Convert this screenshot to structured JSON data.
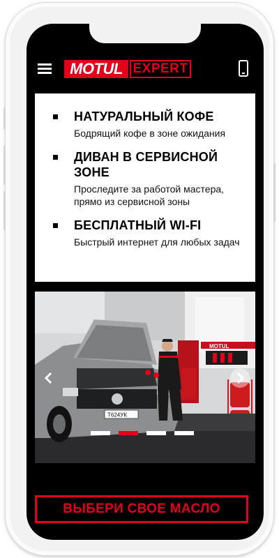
{
  "header": {
    "menu_icon": "hamburger-menu-icon",
    "logo_left": "MOTUL",
    "logo_right": "EXPERT",
    "phone_icon": "mobile-phone-icon",
    "brand_red": "#e3001b"
  },
  "features": [
    {
      "title": "НАТУРАЛЬНЫЙ КОФЕ",
      "desc": "Бодрящий кофе в зоне ожидания"
    },
    {
      "title": "ДИВАН В СЕРВИСНОЙ ЗОНЕ",
      "desc": "Проследите за работой мастера, прямо из сервисной зоны"
    },
    {
      "title": "БЕСПЛАТНЫЙ WI-FI",
      "desc": "Быстрый интернет для любых задач"
    }
  ],
  "slider": {
    "slide_count": 4,
    "active_index": 1,
    "car_plate": "Т624УК",
    "sign_text": "MOTUL",
    "prev_icon": "chevron-left-icon",
    "next_icon": "chevron-right-icon"
  },
  "cta": {
    "label": "ВЫБЕРИ СВОЕ МАСЛО"
  }
}
